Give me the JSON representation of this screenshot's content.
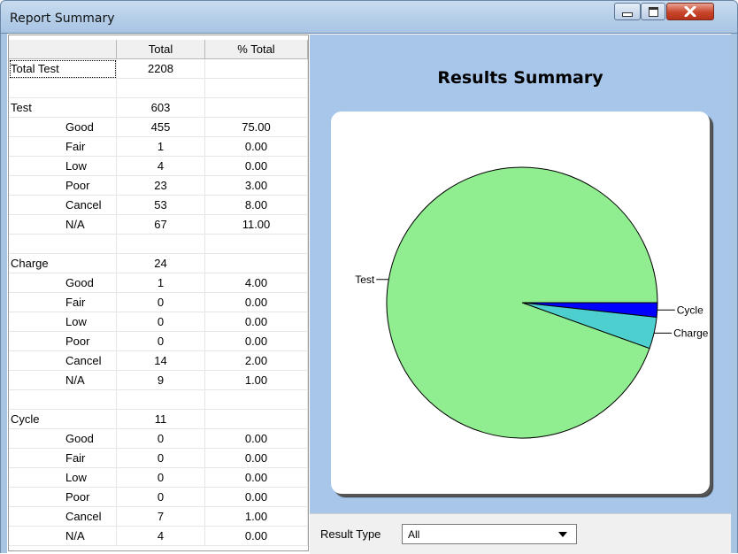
{
  "window": {
    "title": "Report Summary"
  },
  "table": {
    "headers": [
      "",
      "Total",
      "% Total"
    ],
    "rows": [
      {
        "label": "Total Test",
        "total": "2208",
        "pct": "",
        "indent": false
      },
      {
        "label": "",
        "total": "",
        "pct": "",
        "indent": false
      },
      {
        "label": "Test",
        "total": "603",
        "pct": "",
        "indent": false
      },
      {
        "label": "Good",
        "total": "455",
        "pct": "75.00",
        "indent": true
      },
      {
        "label": "Fair",
        "total": "1",
        "pct": "0.00",
        "indent": true
      },
      {
        "label": "Low",
        "total": "4",
        "pct": "0.00",
        "indent": true
      },
      {
        "label": "Poor",
        "total": "23",
        "pct": "3.00",
        "indent": true
      },
      {
        "label": "Cancel",
        "total": "53",
        "pct": "8.00",
        "indent": true
      },
      {
        "label": "N/A",
        "total": "67",
        "pct": "11.00",
        "indent": true
      },
      {
        "label": "",
        "total": "",
        "pct": "",
        "indent": false
      },
      {
        "label": "Charge",
        "total": "24",
        "pct": "",
        "indent": false
      },
      {
        "label": "Good",
        "total": "1",
        "pct": "4.00",
        "indent": true
      },
      {
        "label": "Fair",
        "total": "0",
        "pct": "0.00",
        "indent": true
      },
      {
        "label": "Low",
        "total": "0",
        "pct": "0.00",
        "indent": true
      },
      {
        "label": "Poor",
        "total": "0",
        "pct": "0.00",
        "indent": true
      },
      {
        "label": "Cancel",
        "total": "14",
        "pct": "2.00",
        "indent": true
      },
      {
        "label": "N/A",
        "total": "9",
        "pct": "1.00",
        "indent": true
      },
      {
        "label": "",
        "total": "",
        "pct": "",
        "indent": false
      },
      {
        "label": "Cycle",
        "total": "11",
        "pct": "",
        "indent": false
      },
      {
        "label": "Good",
        "total": "0",
        "pct": "0.00",
        "indent": true
      },
      {
        "label": "Fair",
        "total": "0",
        "pct": "0.00",
        "indent": true
      },
      {
        "label": "Low",
        "total": "0",
        "pct": "0.00",
        "indent": true
      },
      {
        "label": "Poor",
        "total": "0",
        "pct": "0.00",
        "indent": true
      },
      {
        "label": "Cancel",
        "total": "7",
        "pct": "1.00",
        "indent": true
      },
      {
        "label": "N/A",
        "total": "4",
        "pct": "0.00",
        "indent": true
      }
    ]
  },
  "chart_data": {
    "type": "pie",
    "title": "Results Summary",
    "categories": [
      "Test",
      "Charge",
      "Cycle"
    ],
    "values": [
      603,
      24,
      11
    ],
    "colors": [
      "#90ee90",
      "#4ecfcf",
      "#0000ff"
    ]
  },
  "footer": {
    "result_type_label": "Result Type",
    "result_type_value": "All"
  },
  "icons": {
    "minimize": "minimize-icon",
    "maximize": "maximize-icon",
    "close": "close-icon",
    "dropdown": "chevron-down-icon"
  }
}
